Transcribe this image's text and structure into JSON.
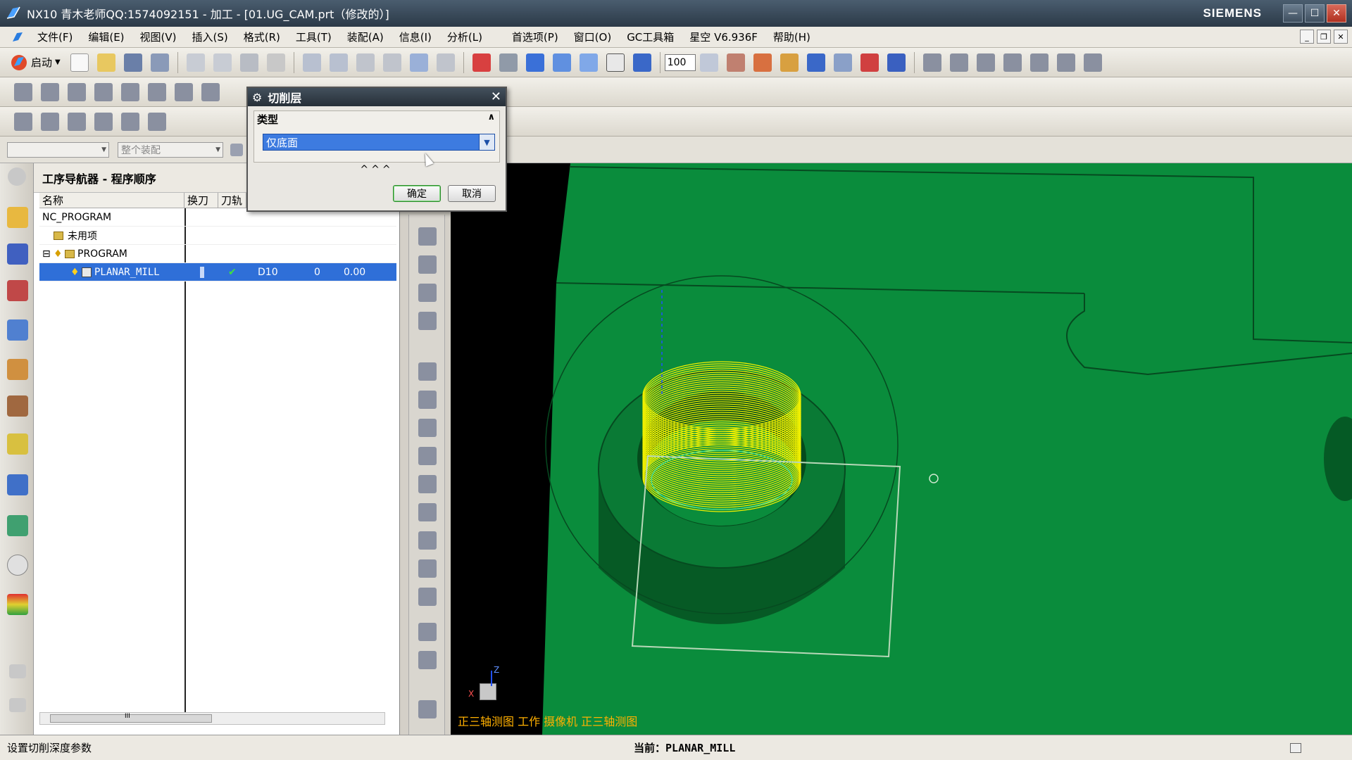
{
  "titlebar": {
    "title": "NX10 青木老师QQ:1574092151 - 加工 - [01.UG_CAM.prt（修改的）]",
    "brand": "SIEMENS",
    "min": "—",
    "max": "☐",
    "close": "✕"
  },
  "menubar": {
    "items": [
      "文件(F)",
      "编辑(E)",
      "视图(V)",
      "插入(S)",
      "格式(R)",
      "工具(T)",
      "装配(A)",
      "信息(I)",
      "分析(L)",
      "首选项(P)",
      "窗口(O)",
      "GC工具箱",
      "星空 V6.936F",
      "帮助(H)"
    ]
  },
  "toolbar": {
    "start_label": "启动",
    "zoom_value": "100"
  },
  "selbar": {
    "combo1": "",
    "combo2": "整个装配"
  },
  "navigator": {
    "title": "工序导航器 - 程序顺序",
    "columns": [
      "名称",
      "换刀",
      "刀轨"
    ],
    "rows": [
      {
        "name": "NC_PROGRAM"
      },
      {
        "name": "未用项"
      },
      {
        "name": "PROGRAM",
        "toggle": "⊟"
      },
      {
        "name": "PLANAR_MILL",
        "tool": "D10",
        "toolno": "0",
        "time": "0.00"
      }
    ],
    "scroll_grip": "III"
  },
  "graphics": {
    "view_label": "正三轴测图 工作 摄像机 正三轴测图",
    "axis_x": "X",
    "axis_z": "Z"
  },
  "dialog": {
    "title": "切削层",
    "group": "类型",
    "type_value": "仅底面",
    "more": "^^^",
    "ok": "确定",
    "cancel": "取消"
  },
  "statusbar": {
    "left": "设置切削深度参数",
    "current_label": "当前：",
    "current_value": "PLANAR_MILL"
  },
  "colors": {
    "part_green": "#0a8c3c",
    "toolpath_yellow": "#f0f000",
    "selection_blue": "#2f6fd8"
  }
}
